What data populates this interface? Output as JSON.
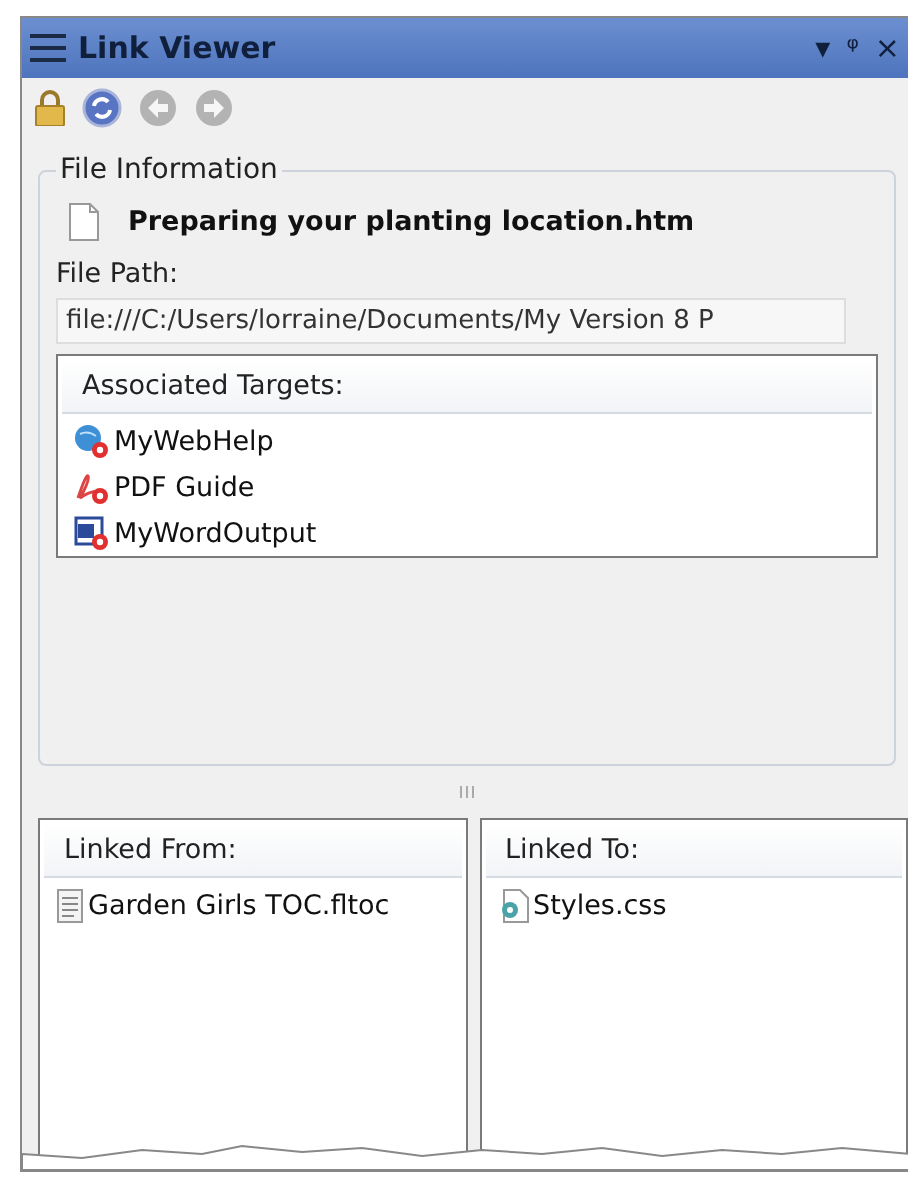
{
  "window": {
    "title": "Link Viewer",
    "controls": [
      "▾",
      "ᵠ",
      "×"
    ]
  },
  "toolbar": [
    {
      "kind": "lock",
      "disabled": false
    },
    {
      "kind": "refresh",
      "disabled": false
    },
    {
      "kind": "back",
      "disabled": true
    },
    {
      "kind": "forward",
      "disabled": true
    }
  ],
  "file_information": {
    "legend": "File Information",
    "file_name": "Preparing your planting location.htm",
    "path_label": "File Path:",
    "path_value": "file:///C:/Users/lorraine/Documents/My Version 8 P",
    "targets_header": "Associated Targets:",
    "targets": [
      {
        "kind": "web",
        "label": "MyWebHelp"
      },
      {
        "kind": "pdf",
        "label": "PDF Guide"
      },
      {
        "kind": "word",
        "label": "MyWordOutput"
      }
    ]
  },
  "linked_from": {
    "header": "Linked From:",
    "items": [
      {
        "kind": "toc",
        "label": "Garden Girls TOC.fltoc"
      }
    ]
  },
  "linked_to": {
    "header": "Linked To:",
    "items": [
      {
        "kind": "css",
        "label": "Styles.css"
      }
    ]
  }
}
